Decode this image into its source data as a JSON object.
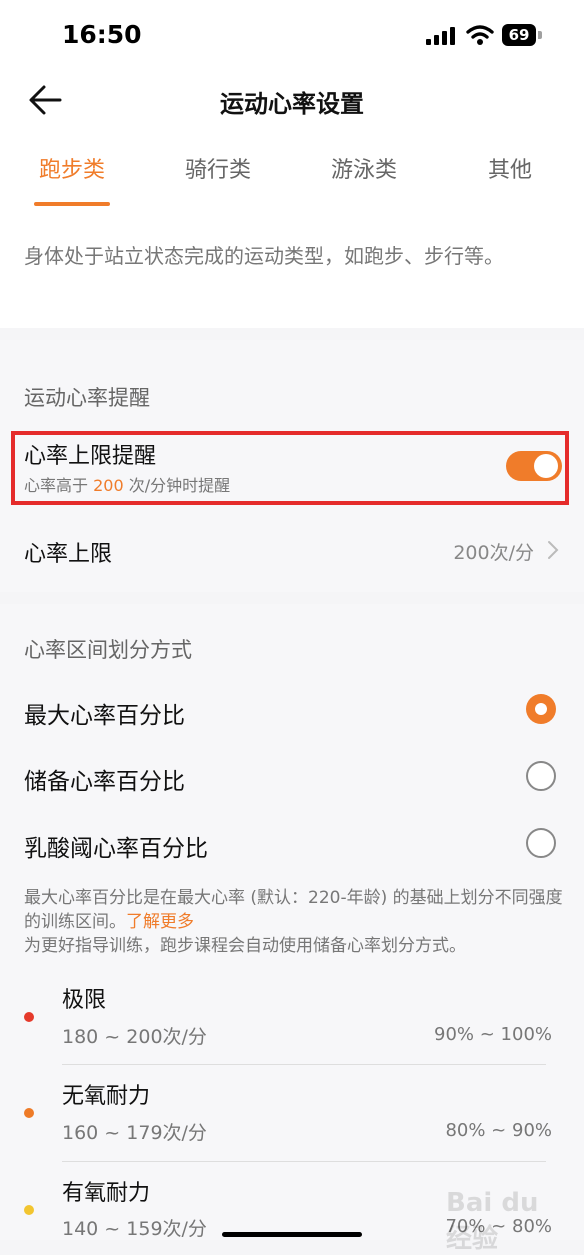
{
  "status_bar": {
    "time": "16:50",
    "battery": "69"
  },
  "header": {
    "title": "运动心率设置"
  },
  "tabs": [
    {
      "label": "跑步类",
      "active": true
    },
    {
      "label": "骑行类",
      "active": false
    },
    {
      "label": "游泳类",
      "active": false
    },
    {
      "label": "其他",
      "active": false
    }
  ],
  "description": "身体处于站立状态完成的运动类型，如跑步、步行等。",
  "reminder": {
    "section_title": "运动心率提醒",
    "limit_alert": {
      "title": "心率上限提醒",
      "sub_prefix": "心率高于 ",
      "sub_value": "200",
      "sub_suffix": " 次/分钟时提醒",
      "enabled": true
    },
    "limit": {
      "label": "心率上限",
      "value": "200次/分"
    }
  },
  "zones_method": {
    "section_title": "心率区间划分方式",
    "options": [
      {
        "label": "最大心率百分比",
        "selected": true
      },
      {
        "label": "储备心率百分比",
        "selected": false
      },
      {
        "label": "乳酸阈心率百分比",
        "selected": false
      }
    ],
    "note_line1": "最大心率百分比是在最大心率 (默认：220-年龄) 的基础上划分不同强度的训练区间。",
    "note_link": "了解更多",
    "note_line2": "为更好指导训练，跑步课程会自动使用储备心率划分方式。"
  },
  "zones": [
    {
      "name": "极限",
      "range": "180 ~ 200次/分",
      "pct": "90% ~ 100%",
      "color": "#e53a2b"
    },
    {
      "name": "无氧耐力",
      "range": "160 ~ 179次/分",
      "pct": "80% ~ 90%",
      "color": "#ee7b27"
    },
    {
      "name": "有氧耐力",
      "range": "140 ~ 159次/分",
      "pct": "70% ~ 80%",
      "color": "#f2c530"
    }
  ],
  "watermark": "Bai du 经验",
  "colors": {
    "accent": "#f07c2a",
    "highlight_border": "#e52b2b"
  }
}
